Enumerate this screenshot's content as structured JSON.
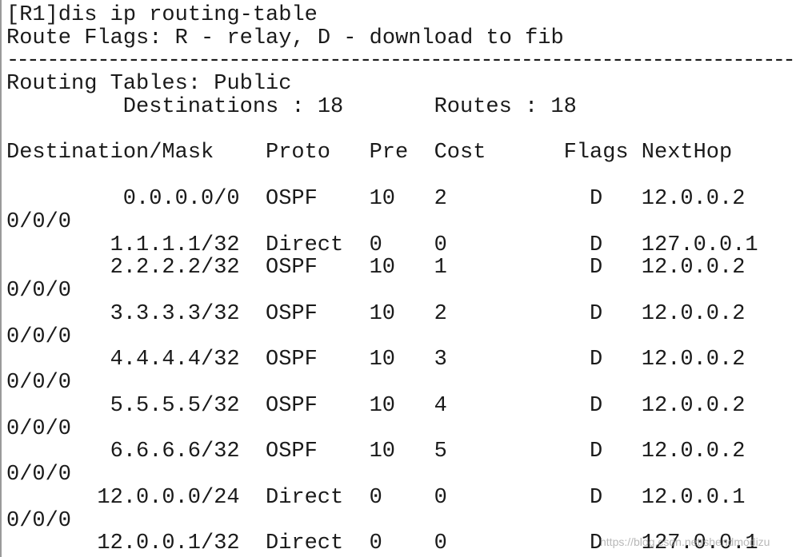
{
  "command": "[R1]dis ip routing-table",
  "route_flags": "Route Flags: R - relay, D - download to fib",
  "separator": "------------------------------------------------------------------------------",
  "table_name": "Routing Tables: Public",
  "destinations_label": "Destinations : 18",
  "routes_label": "Routes : 18",
  "headers": {
    "destination": "Destination/Mask",
    "proto": "Proto",
    "pre": "Pre",
    "cost": "Cost",
    "flags": "Flags",
    "nexthop": "NextHop"
  },
  "routes": [
    {
      "destination": "0.0.0.0/0",
      "proto": "OSPF",
      "pre": "10",
      "cost": "2",
      "flags": "D",
      "nexthop": "12.0.0.2",
      "interface": "0/0/0"
    },
    {
      "destination": "1.1.1.1/32",
      "proto": "Direct",
      "pre": "0",
      "cost": "0",
      "flags": "D",
      "nexthop": "127.0.0.1",
      "interface": ""
    },
    {
      "destination": "2.2.2.2/32",
      "proto": "OSPF",
      "pre": "10",
      "cost": "1",
      "flags": "D",
      "nexthop": "12.0.0.2",
      "interface": "0/0/0"
    },
    {
      "destination": "3.3.3.3/32",
      "proto": "OSPF",
      "pre": "10",
      "cost": "2",
      "flags": "D",
      "nexthop": "12.0.0.2",
      "interface": "0/0/0"
    },
    {
      "destination": "4.4.4.4/32",
      "proto": "OSPF",
      "pre": "10",
      "cost": "3",
      "flags": "D",
      "nexthop": "12.0.0.2",
      "interface": "0/0/0"
    },
    {
      "destination": "5.5.5.5/32",
      "proto": "OSPF",
      "pre": "10",
      "cost": "4",
      "flags": "D",
      "nexthop": "12.0.0.2",
      "interface": "0/0/0"
    },
    {
      "destination": "6.6.6.6/32",
      "proto": "OSPF",
      "pre": "10",
      "cost": "5",
      "flags": "D",
      "nexthop": "12.0.0.2",
      "interface": "0/0/0"
    },
    {
      "destination": "12.0.0.0/24",
      "proto": "Direct",
      "pre": "0",
      "cost": "0",
      "flags": "D",
      "nexthop": "12.0.0.1",
      "interface": "0/0/0"
    },
    {
      "destination": "12.0.0.1/32",
      "proto": "Direct",
      "pre": "0",
      "cost": "0",
      "flags": "D",
      "nexthop": "127.0.0.1",
      "interface": ""
    }
  ],
  "watermark": "https://blog.csdn.net/shendmodizu"
}
